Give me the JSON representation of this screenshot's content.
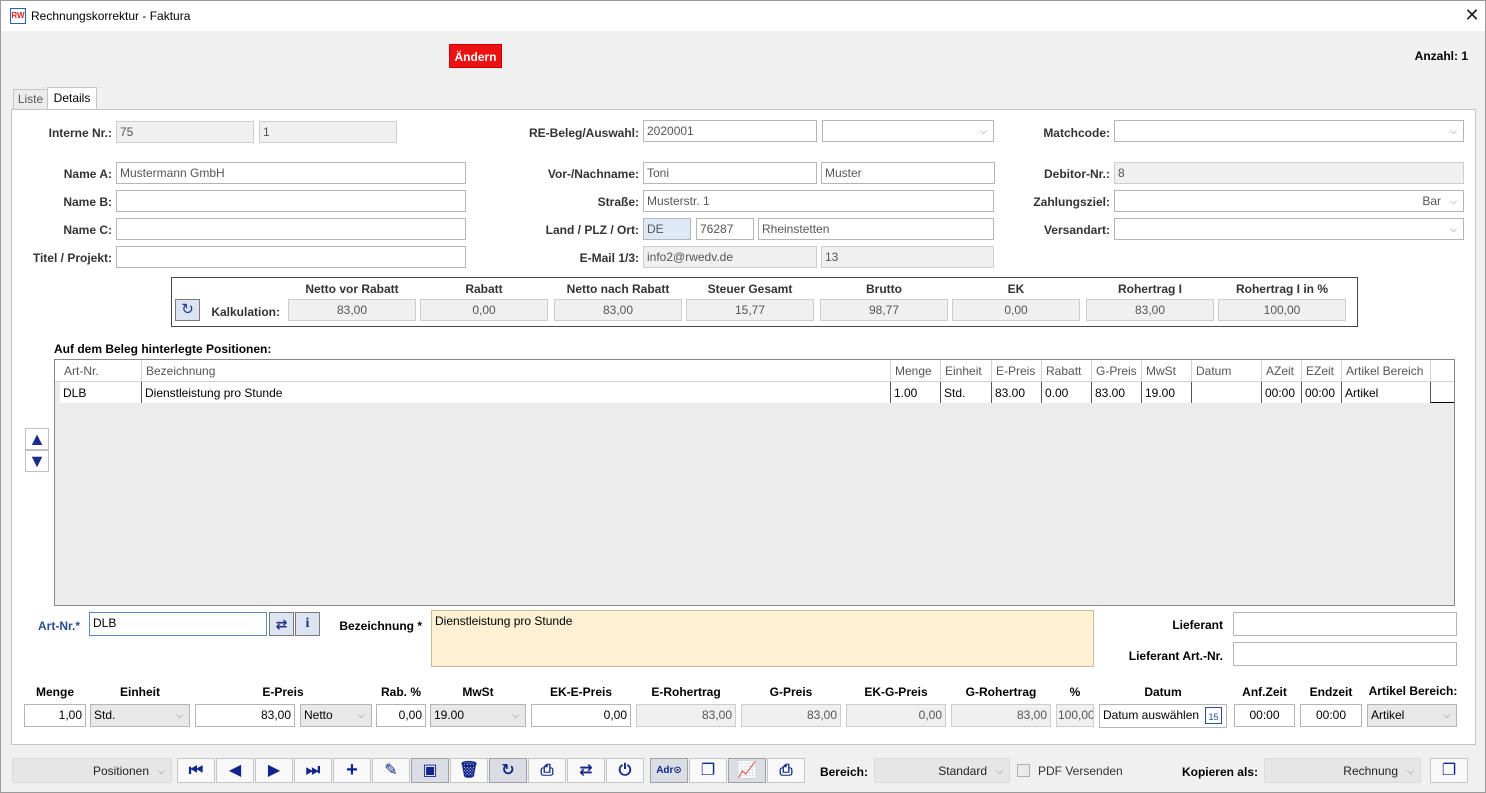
{
  "window": {
    "title": "Rechnungskorrektur - Faktura",
    "app_icon": "RW"
  },
  "topbar": {
    "edit_button": "Ändern",
    "count": "Anzahl: 1"
  },
  "tabs": [
    {
      "label": "Liste"
    },
    {
      "label": "Details"
    }
  ],
  "form": {
    "interne_nr": {
      "label": "Interne Nr.:",
      "value1": "75",
      "value2": "1"
    },
    "re_beleg": {
      "label": "RE-Beleg/Auswahl:",
      "value": "2020001",
      "select": ""
    },
    "matchcode": {
      "label": "Matchcode:",
      "value": ""
    },
    "name_a": {
      "label": "Name A:",
      "value": "Mustermann GmbH"
    },
    "name_b": {
      "label": "Name B:",
      "value": ""
    },
    "name_c": {
      "label": "Name C:",
      "value": ""
    },
    "titel": {
      "label": "Titel / Projekt:",
      "value": ""
    },
    "vor_nachname": {
      "label": "Vor-/Nachname:",
      "vorname": "Toni",
      "nachname": "Muster"
    },
    "strasse": {
      "label": "Straße:",
      "value": "Musterstr. 1"
    },
    "land_plz_ort": {
      "label": "Land / PLZ / Ort:",
      "land": "DE",
      "plz": "76287",
      "ort": "Rheinstetten"
    },
    "email": {
      "label": "E-Mail 1/3:",
      "value": "info2@rwedv.de",
      "value2": "13"
    },
    "debitor": {
      "label": "Debitor-Nr.:",
      "value": "8"
    },
    "zahlungsziel": {
      "label": "Zahlungsziel:",
      "value": "Bar"
    },
    "versandart": {
      "label": "Versandart:",
      "value": ""
    }
  },
  "kalkulation": {
    "label": "Kalkulation:",
    "columns": [
      {
        "header": "Netto vor Rabatt",
        "value": "83,00"
      },
      {
        "header": "Rabatt",
        "value": "0,00"
      },
      {
        "header": "Netto nach Rabatt",
        "value": "83,00"
      },
      {
        "header": "Steuer Gesamt",
        "value": "15,77"
      },
      {
        "header": "Brutto",
        "value": "98,77"
      },
      {
        "header": "EK",
        "value": "0,00"
      },
      {
        "header": "Rohertrag I",
        "value": "83,00"
      },
      {
        "header": "Rohertrag I in %",
        "value": "100,00"
      }
    ]
  },
  "positions": {
    "title": "Auf dem Beleg hinterlegte Positionen:",
    "headers": [
      "Art-Nr.",
      "Bezeichnung",
      "Menge",
      "Einheit",
      "E-Preis",
      "Rabatt",
      "G-Preis",
      "MwSt",
      "Datum",
      "AZeit",
      "EZeit",
      "Artikel Bereich"
    ],
    "rows": [
      [
        "DLB",
        "Dienstleistung pro Stunde",
        "1.00",
        "Std.",
        "83.00",
        "0.00",
        "83.00",
        "19.00",
        "",
        "00:00",
        "00:00",
        "Artikel"
      ]
    ]
  },
  "editor": {
    "art_nr_label": "Art-Nr.*",
    "art_nr_value": "DLB",
    "bezeichnung_label": "Bezeichnung *",
    "bezeichnung_value": "Dienstleistung pro Stunde",
    "lieferant_label": "Lieferant",
    "lieferant_value": "",
    "lieferant_art_label": "Lieferant Art.-Nr.",
    "lieferant_art_value": ""
  },
  "bottom": {
    "headers": {
      "menge": "Menge",
      "einheit": "Einheit",
      "epreis": "E-Preis",
      "rab": "Rab. %",
      "mwst": "MwSt",
      "ek_epreis": "EK-E-Preis",
      "e_rohertrag": "E-Rohertrag",
      "gpreis": "G-Preis",
      "ek_gpreis": "EK-G-Preis",
      "g_rohertrag": "G-Rohertrag",
      "pct": "%",
      "datum": "Datum",
      "anfzeit": "Anf.Zeit",
      "endzeit": "Endzeit",
      "bereich": "Artikel Bereich:"
    },
    "values": {
      "menge": "1,00",
      "einheit": "Std.",
      "epreis": "83,00",
      "netto": "Netto",
      "rab": "0,00",
      "mwst": "19.00",
      "ek_epreis": "0,00",
      "e_rohertrag": "83,00",
      "gpreis": "83,00",
      "ek_gpreis": "0,00",
      "g_rohertrag": "83,00",
      "pct": "100,00",
      "datum": "Datum auswählen",
      "anfzeit": "00:00",
      "endzeit": "00:00",
      "bereich": "Artikel"
    },
    "calendar_day": "15"
  },
  "toolbar": {
    "positions": "Positionen",
    "adr": "Adr⊙",
    "bereich_label": "Bereich:",
    "bereich_value": "Standard",
    "pdf_label": "PDF Versenden",
    "kopieren_label": "Kopieren als:",
    "kopieren_value": "Rechnung"
  },
  "colors": {
    "accent": "#1c2f7c",
    "danger": "#ee1111",
    "label_blue": "#2a4f8c"
  }
}
